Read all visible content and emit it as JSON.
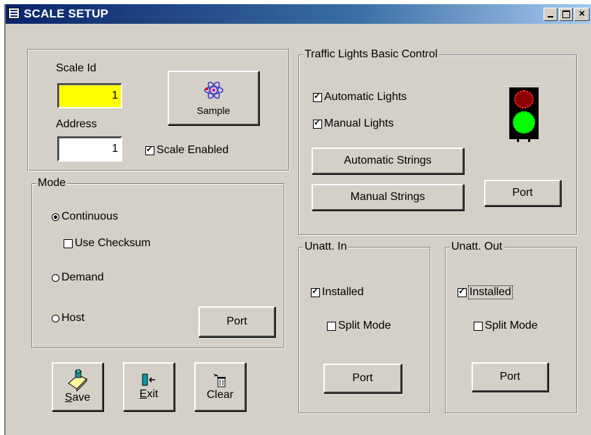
{
  "window": {
    "title": "SCALE SETUP",
    "min_icon": "minimize-icon",
    "max_icon": "maximize-icon",
    "close_icon": "close-icon"
  },
  "scale": {
    "id_label": "Scale Id",
    "id_value": "1",
    "address_label": "Address",
    "address_value": "1",
    "enabled_label": "Scale Enabled",
    "enabled": true,
    "sample_label": "Sample",
    "id_bg": "#ffff00"
  },
  "mode": {
    "title": "Mode",
    "continuous_label": "Continuous",
    "continuous": true,
    "checksum_label": "Use Checksum",
    "checksum": false,
    "demand_label": "Demand",
    "host_label": "Host",
    "port_label": "Port"
  },
  "traffic": {
    "title": "Traffic Lights Basic Control",
    "auto_label": "Automatic Lights",
    "auto": true,
    "manual_label": "Manual Lights",
    "manual": true,
    "auto_strings_label": "Automatic Strings",
    "manual_strings_label": "Manual Strings",
    "port_label": "Port",
    "red_color": "#8b0000",
    "green_color": "#00ff00"
  },
  "unatt_in": {
    "title": "Unatt. In",
    "installed_label": "Installed",
    "installed": true,
    "split_label": "Split Mode",
    "split": false,
    "port_label": "Port"
  },
  "unatt_out": {
    "title": "Unatt. Out",
    "installed_label": "Installed",
    "installed": true,
    "split_label": "Split Mode",
    "split": false,
    "port_label": "Port"
  },
  "toolbar": {
    "save_key": "S",
    "save_rest": "ave",
    "exit_key": "E",
    "exit_rest": "xit",
    "clear_label": "Clear"
  }
}
